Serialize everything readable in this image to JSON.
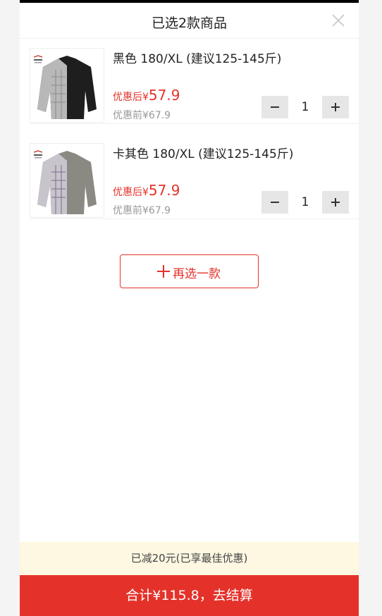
{
  "header": {
    "title": "已选2款商品"
  },
  "items": [
    {
      "name": "黑色 180/XL (建议125-145斤)",
      "after_label": "优惠后¥",
      "after_value": "57.9",
      "before": "优惠前¥67.9",
      "qty": "1",
      "jacket_color": "#1e1e1e"
    },
    {
      "name": "卡其色 180/XL (建议125-145斤)",
      "after_label": "优惠后¥",
      "after_value": "57.9",
      "before": "优惠前¥67.9",
      "qty": "1",
      "jacket_color": "#8a8a82"
    }
  ],
  "add_more": {
    "label": "再选一款"
  },
  "discount": {
    "text": "已减20元(已享最佳优惠)"
  },
  "checkout": {
    "label": "合计¥115.8，去结算"
  },
  "colors": {
    "accent": "#e4322b",
    "banner": "#fef8e2"
  },
  "icons": {
    "close": "close-icon",
    "minus": "minus-icon",
    "plus": "plus-icon"
  }
}
